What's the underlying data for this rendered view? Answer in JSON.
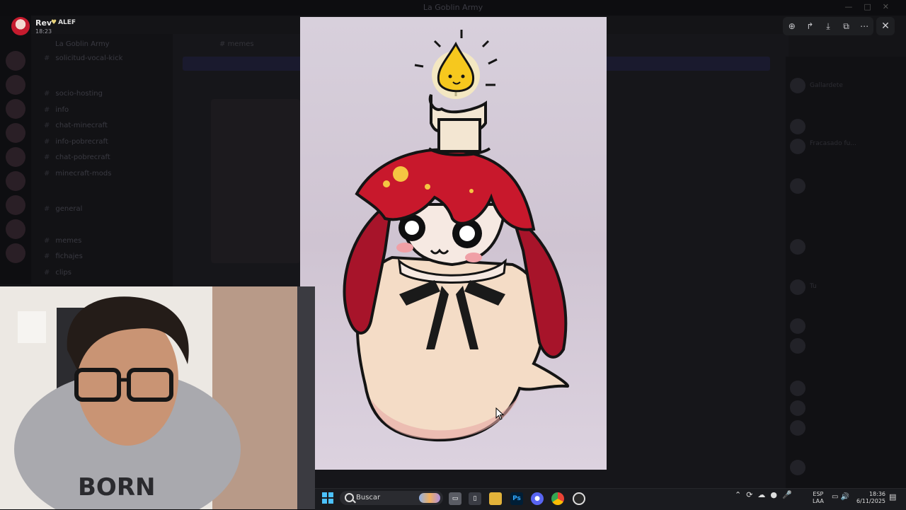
{
  "window": {
    "title": "La Goblin Army"
  },
  "viewer": {
    "author": {
      "name": "Rev",
      "badge": "ALEF",
      "time": "18:23"
    },
    "toolbar": {
      "zoom_icon": "zoom-in-icon",
      "forward_icon": "forward-icon",
      "download_icon": "download-icon",
      "open_icon": "open-external-icon",
      "more_icon": "more-icon",
      "close_icon": "close-icon"
    }
  },
  "background": {
    "server_name": "La Goblin Army",
    "channels": [
      "solicitud-vocal-kick",
      "socio-hosting",
      "info",
      "chat-minecraft",
      "info-pobrecraft",
      "chat-pobrecraft",
      "minecraft-mods",
      "general",
      "memes",
      "fichajes",
      "clips"
    ],
    "chat_header": "memes",
    "banner_text": "",
    "members": [
      "Gallardete",
      "Fracasado fu...",
      "Tu"
    ]
  },
  "taskbar": {
    "search_label": "Buscar",
    "apps": [
      "file-explorer",
      "photoshop",
      "discord",
      "chrome",
      "obs"
    ],
    "language": [
      "ESP",
      "LAA"
    ],
    "clock": {
      "time": "18:36",
      "date": "6/11/2025"
    }
  },
  "colors": {
    "hair": "#c8182c",
    "flame": "#f6c81e",
    "candle": "#f3e6d2",
    "ghost": "#f4dcc6"
  }
}
